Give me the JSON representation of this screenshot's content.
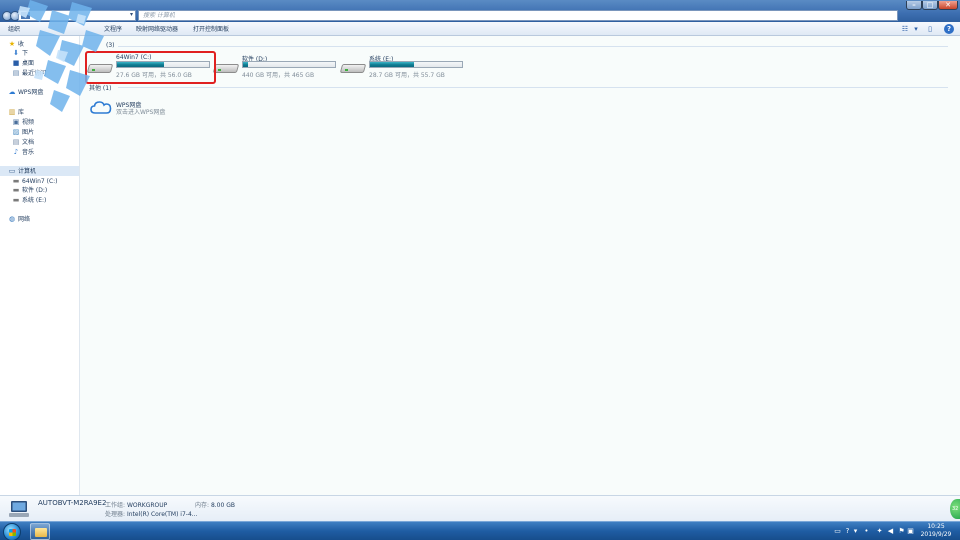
{
  "window": {
    "search_placeholder": "搜索 计算机",
    "min_glyph": "–",
    "max_glyph": "□",
    "close_glyph": "✕"
  },
  "command_bar": {
    "organize_partial": "组织",
    "items": [
      "文程序",
      "映射网络驱动器",
      "打开控制面板"
    ]
  },
  "nav": {
    "favorites_partial": "收",
    "fav_items": [
      "下",
      "桌面",
      "最近访问"
    ],
    "wps": "WPS网盘",
    "libraries_partial": "库",
    "lib_items": [
      "视频",
      "图片",
      "文档",
      "音乐"
    ],
    "computer": "计算机",
    "computer_items": [
      "64Win7 (C:)",
      "软件 (D:)",
      "系统 (E:)"
    ],
    "network": "网络"
  },
  "main": {
    "drives_group_count": "(3)",
    "drives": [
      {
        "name": "64Win7 (C:)",
        "free": "27.6 GB 可用，共 56.0 GB",
        "used_fraction": 0.51
      },
      {
        "name": "软件 (D:)",
        "free": "440 GB 可用，共 465 GB",
        "used_fraction": 0.05
      },
      {
        "name": "系统 (E:)",
        "free": "28.7 GB 可用，共 55.7 GB",
        "used_fraction": 0.48
      }
    ],
    "other_group": "其他 (1)",
    "wps_name": "WPS网盘",
    "wps_desc": "双击进入WPS网盘"
  },
  "details": {
    "computer_name": "AUTOBVT-M2RA9E2",
    "workgroup_label": "工作组:",
    "workgroup_value": "WORKGROUP",
    "memory_label": "内存:",
    "memory_value": "8.00 GB",
    "cpu_label": "处理器:",
    "cpu_value": "Intel(R) Core(TM) i7-4..."
  },
  "taskbar": {
    "time": "10:25",
    "date": "2019/9/29",
    "badge": "32"
  },
  "colors": {
    "highlight": "#e02020",
    "drive_fill": "#0f7c92",
    "taskbar": "#1f5da3"
  }
}
